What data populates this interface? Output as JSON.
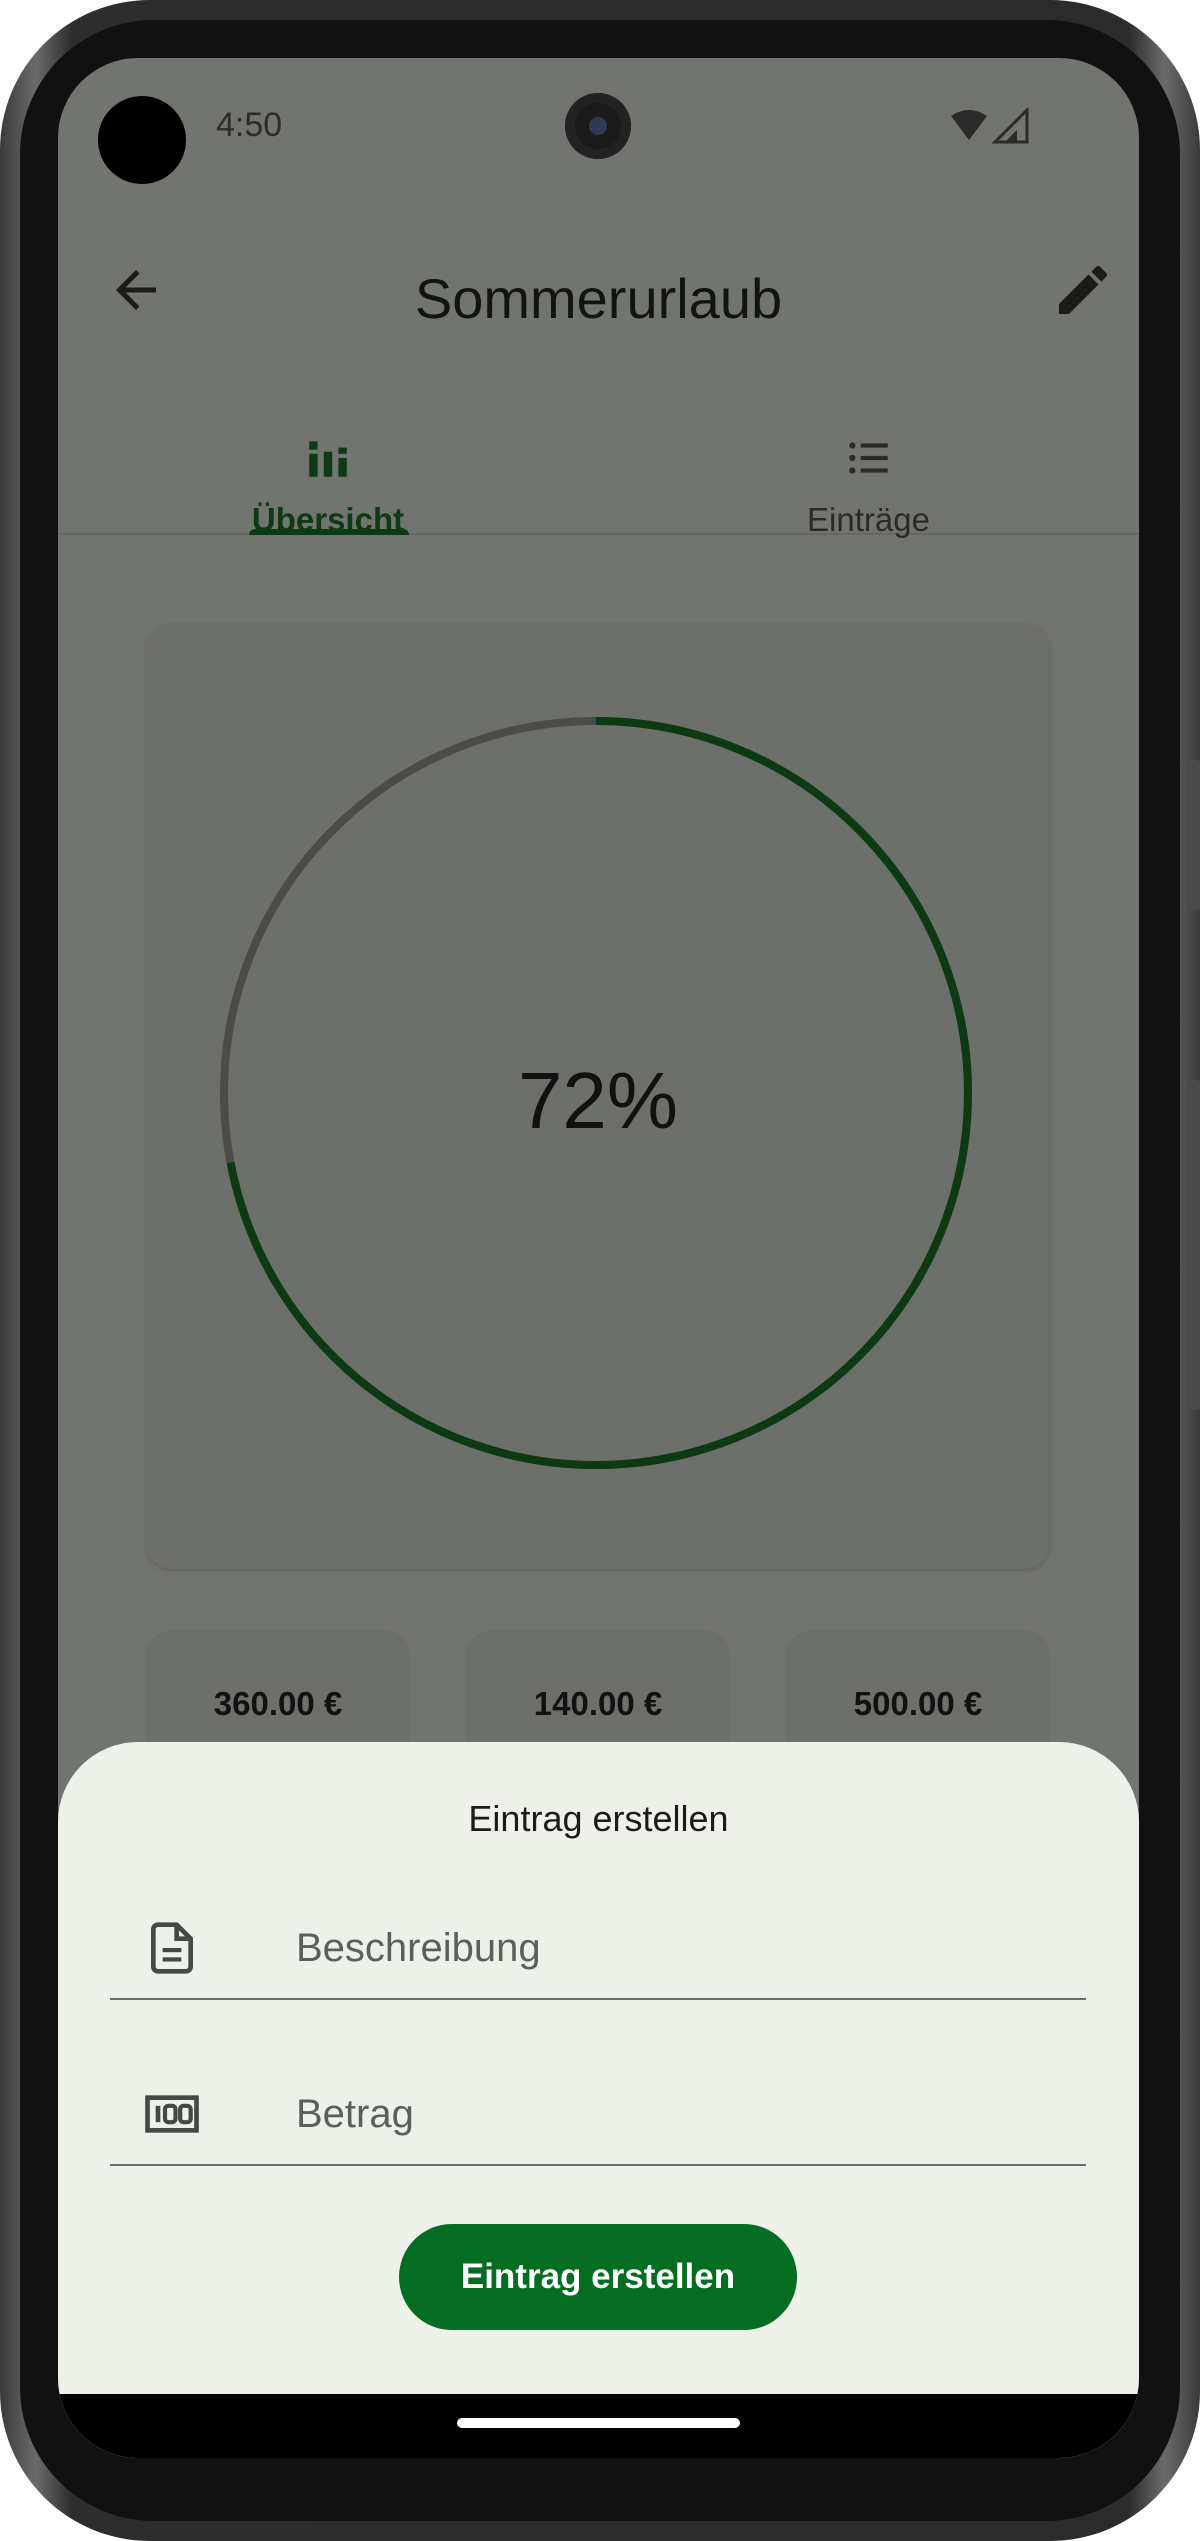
{
  "status_bar": {
    "time": "4:50"
  },
  "app_bar": {
    "title": "Sommerurlaub",
    "back_icon": "arrow-back-icon",
    "edit_icon": "pencil-icon"
  },
  "tabs": [
    {
      "label": "Übersicht",
      "icon": "bar-chart-icon",
      "selected": true
    },
    {
      "label": "Einträge",
      "icon": "list-icon",
      "selected": false
    }
  ],
  "progress": {
    "percent_label": "72%",
    "fraction": 0.72
  },
  "stats": [
    {
      "value": "360.00 €"
    },
    {
      "value": "140.00 €"
    },
    {
      "value": "500.00 €"
    }
  ],
  "sheet": {
    "title": "Eintrag erstellen",
    "description_field": {
      "placeholder": "Beschreibung",
      "value": "",
      "icon": "document-icon"
    },
    "amount_field": {
      "placeholder": "Betrag",
      "value": "",
      "icon": "banknote-icon"
    },
    "submit_label": "Eintrag erstellen"
  },
  "colors": {
    "primary": "#046d21",
    "primary_dark": "#0c3a12",
    "sheet_background": "#edf1e9",
    "scrim_background": "#72746f"
  }
}
